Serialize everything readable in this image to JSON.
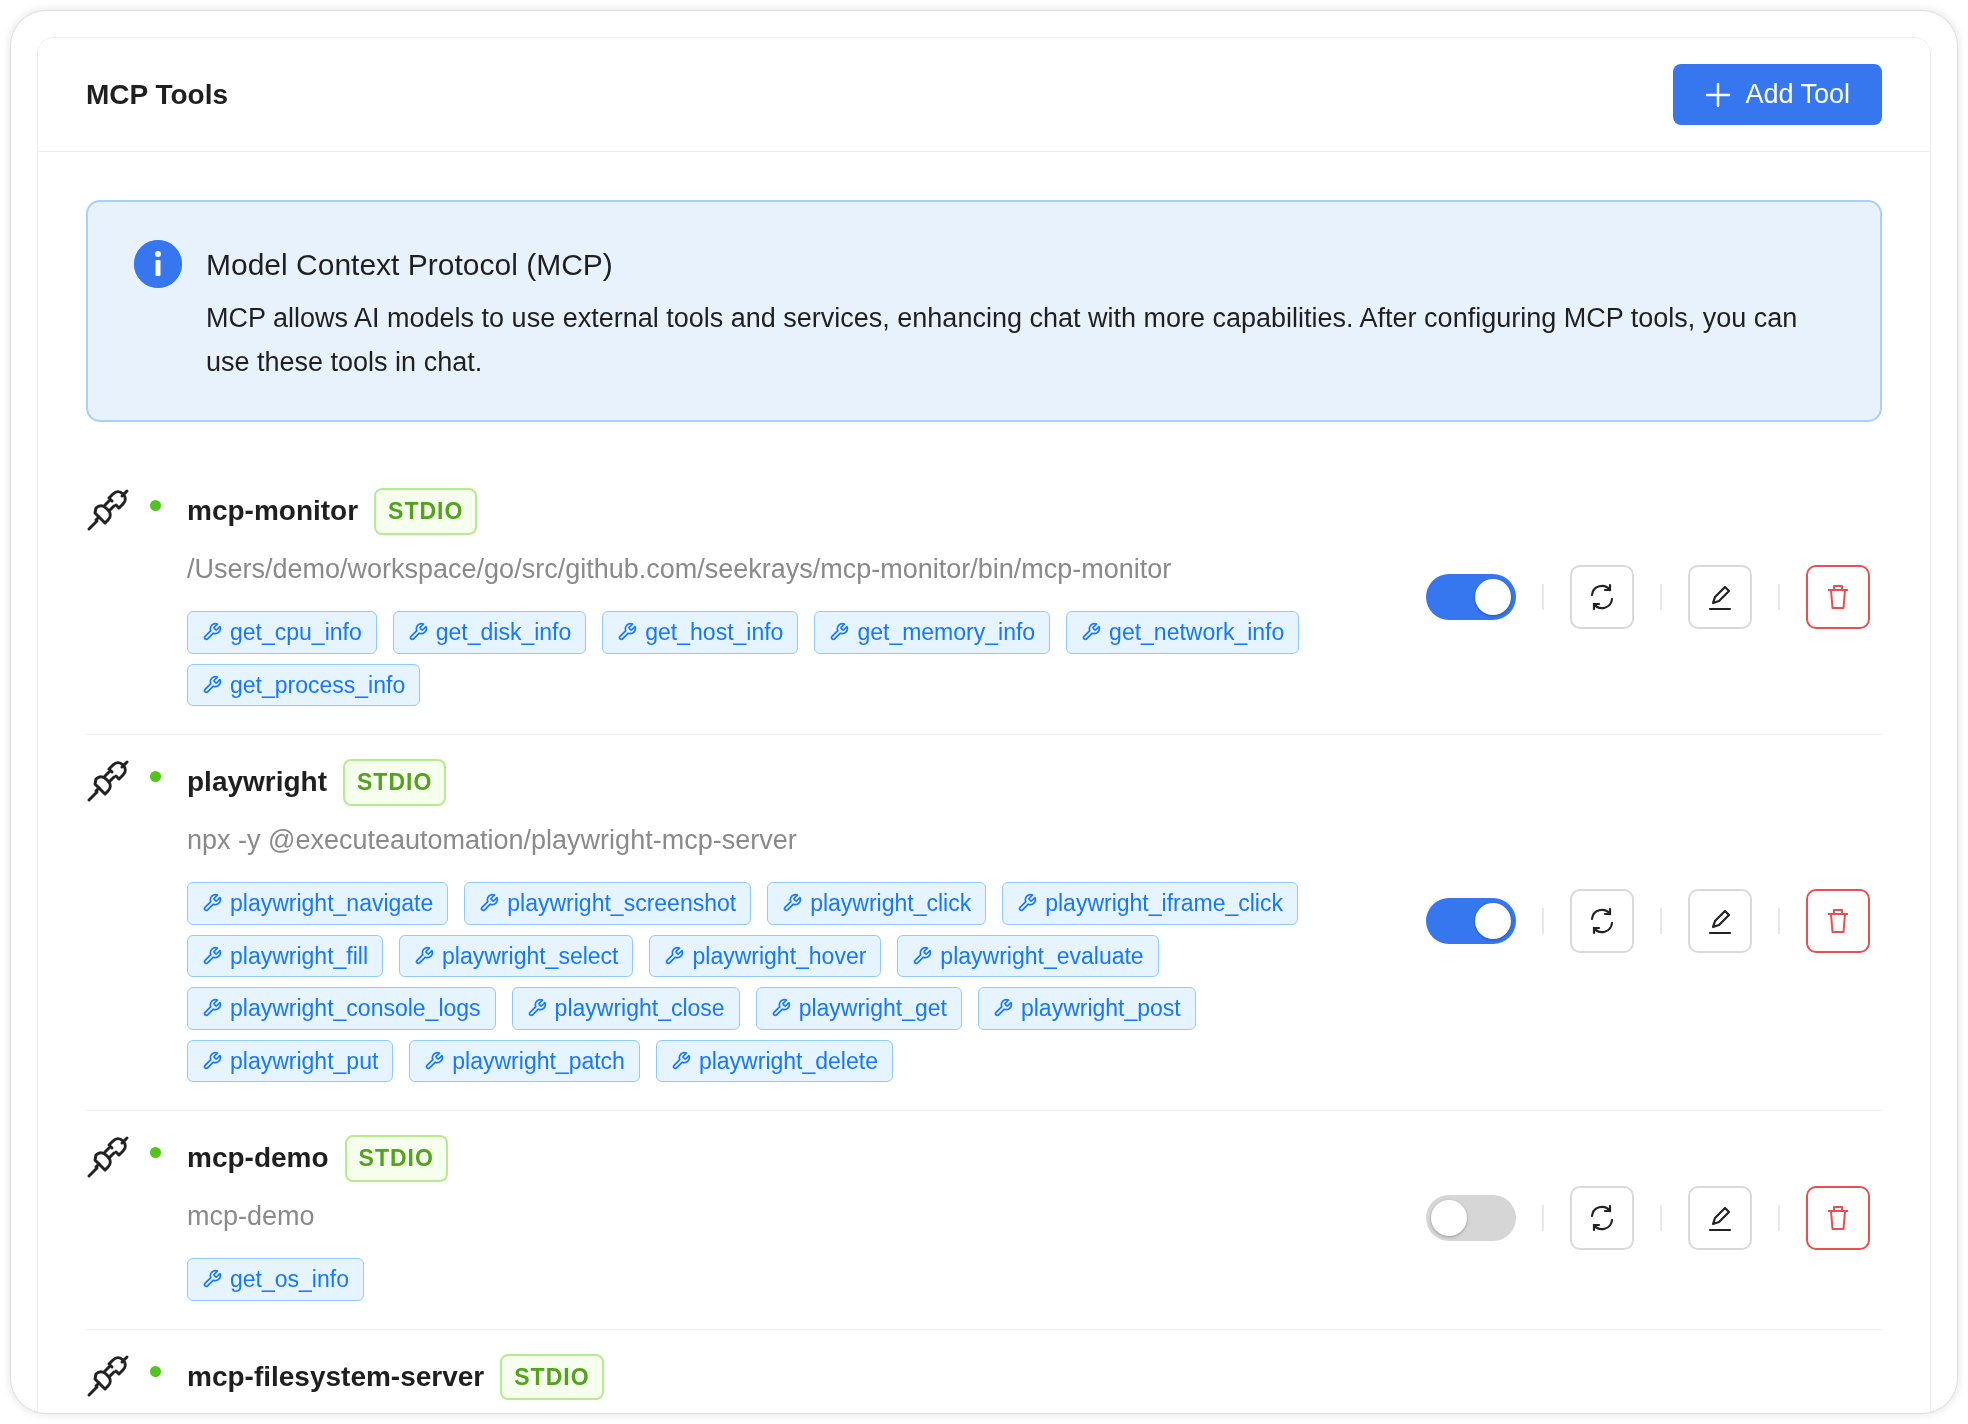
{
  "header": {
    "title": "MCP Tools",
    "add_button": "Add Tool"
  },
  "info": {
    "title": "Model Context Protocol (MCP)",
    "text": "MCP allows AI models to use external tools and services, enhancing chat with more capabilities. After configuring MCP tools, you can use these tools in chat."
  },
  "servers": [
    {
      "name": "mcp-monitor",
      "transport": "STDIO",
      "connected": true,
      "command": "/Users/demo/workspace/go/src/github.com/seekrays/mcp-monitor/bin/mcp-monitor",
      "tools": [
        "get_cpu_info",
        "get_disk_info",
        "get_host_info",
        "get_memory_info",
        "get_network_info",
        "get_process_info"
      ],
      "enabled": true
    },
    {
      "name": "playwright",
      "transport": "STDIO",
      "connected": true,
      "command": "npx -y @executeautomation/playwright-mcp-server",
      "tools": [
        "playwright_navigate",
        "playwright_screenshot",
        "playwright_click",
        "playwright_iframe_click",
        "playwright_fill",
        "playwright_select",
        "playwright_hover",
        "playwright_evaluate",
        "playwright_console_logs",
        "playwright_close",
        "playwright_get",
        "playwright_post",
        "playwright_put",
        "playwright_patch",
        "playwright_delete"
      ],
      "enabled": true
    },
    {
      "name": "mcp-demo",
      "transport": "STDIO",
      "connected": true,
      "command": "mcp-demo",
      "tools": [
        "get_os_info"
      ],
      "enabled": false
    },
    {
      "name": "mcp-filesystem-server",
      "transport": "STDIO",
      "connected": true
    }
  ]
}
